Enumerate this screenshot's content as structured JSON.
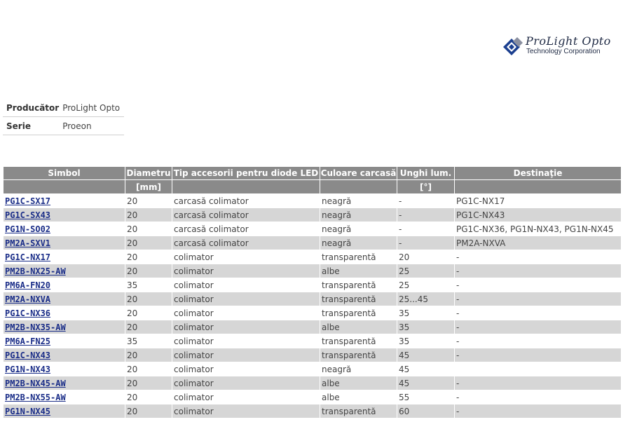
{
  "logo": {
    "name": "ProLight Opto",
    "sub": "Technology Corporation"
  },
  "meta": [
    {
      "key": "Producător",
      "value": "ProLight Opto"
    },
    {
      "key": "Serie",
      "value": "Proeon"
    }
  ],
  "table": {
    "headers": [
      "Simbol",
      "Diametru",
      "Tip accesorii pentru diode LED",
      "Culoare carcasă",
      "Unghi lum.",
      "Destinaţie"
    ],
    "units": [
      "",
      "[mm]",
      "",
      "",
      "[°]",
      ""
    ],
    "rows": [
      [
        "PG1C-SX17",
        "20",
        "carcasă colimator",
        "neagră",
        "-",
        "PG1C-NX17"
      ],
      [
        "PG1C-SX43",
        "20",
        "carcasă colimator",
        "neagră",
        "-",
        "PG1C-NX43"
      ],
      [
        "PG1N-SO02",
        "20",
        "carcasă colimator",
        "neagră",
        "-",
        "PG1C-NX36, PG1N-NX43, PG1N-NX45"
      ],
      [
        "PM2A-SXV1",
        "20",
        "carcasă colimator",
        "neagră",
        "-",
        "PM2A-NXVA"
      ],
      [
        "PG1C-NX17",
        "20",
        "colimator",
        "transparentă",
        "20",
        "-"
      ],
      [
        "PM2B-NX25-AW",
        "20",
        "colimator",
        "albe",
        "25",
        "-"
      ],
      [
        "PM6A-FN20",
        "35",
        "colimator",
        "transparentă",
        "25",
        "-"
      ],
      [
        "PM2A-NXVA",
        "20",
        "colimator",
        "transparentă",
        "25...45",
        "-"
      ],
      [
        "PG1C-NX36",
        "20",
        "colimator",
        "transparentă",
        "35",
        "-"
      ],
      [
        "PM2B-NX35-AW",
        "20",
        "colimator",
        "albe",
        "35",
        "-"
      ],
      [
        "PM6A-FN25",
        "35",
        "colimator",
        "transparentă",
        "35",
        "-"
      ],
      [
        "PG1C-NX43",
        "20",
        "colimator",
        "transparentă",
        "45",
        "-"
      ],
      [
        "PG1N-NX43",
        "20",
        "colimator",
        "neagră",
        "45",
        ""
      ],
      [
        "PM2B-NX45-AW",
        "20",
        "colimator",
        "albe",
        "45",
        "-"
      ],
      [
        "PM2B-NX55-AW",
        "20",
        "colimator",
        "albe",
        "55",
        "-"
      ],
      [
        "PG1N-NX45",
        "20",
        "colimator",
        "transparentă",
        "60",
        "-"
      ]
    ]
  }
}
